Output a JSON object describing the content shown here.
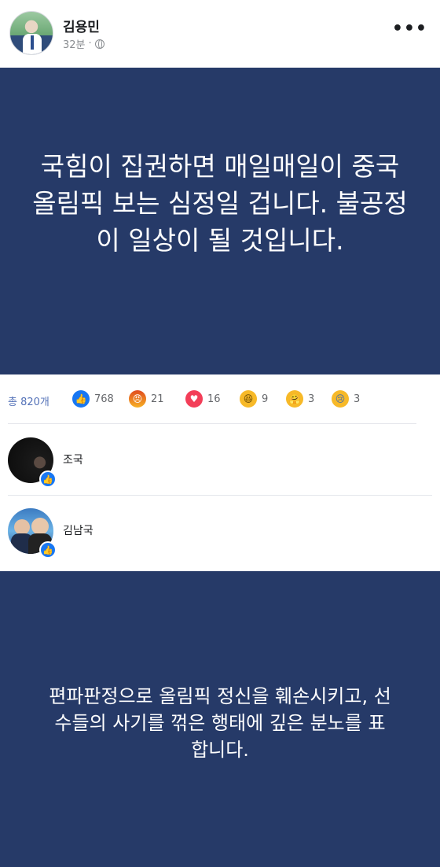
{
  "header": {
    "author": "김용민",
    "time": "32분",
    "separator": "·"
  },
  "post": {
    "text": "국힘이 집권하면 매일매일이 중국올림픽 보는 심정일 겁니다. 불공정이 일상이 될 것입니다."
  },
  "reactions": {
    "total": "총 820개",
    "items": [
      {
        "icon": "like-icon",
        "count": "768"
      },
      {
        "icon": "angry-icon",
        "count": "21"
      },
      {
        "icon": "love-icon",
        "count": "16"
      },
      {
        "icon": "haha-icon",
        "count": "9"
      },
      {
        "icon": "care-icon",
        "count": "3"
      },
      {
        "icon": "sad-icon",
        "count": "3"
      }
    ]
  },
  "comments": [
    {
      "name": "조국"
    },
    {
      "name": "김남국"
    }
  ],
  "post2": {
    "text": "편파판정으로 올림픽 정신을 훼손시키고, 선수들의 사기를 꺾은 행태에 깊은 분노를 표합니다."
  },
  "colors": {
    "post_bg": "#263a68",
    "like_blue": "#1877f2"
  }
}
